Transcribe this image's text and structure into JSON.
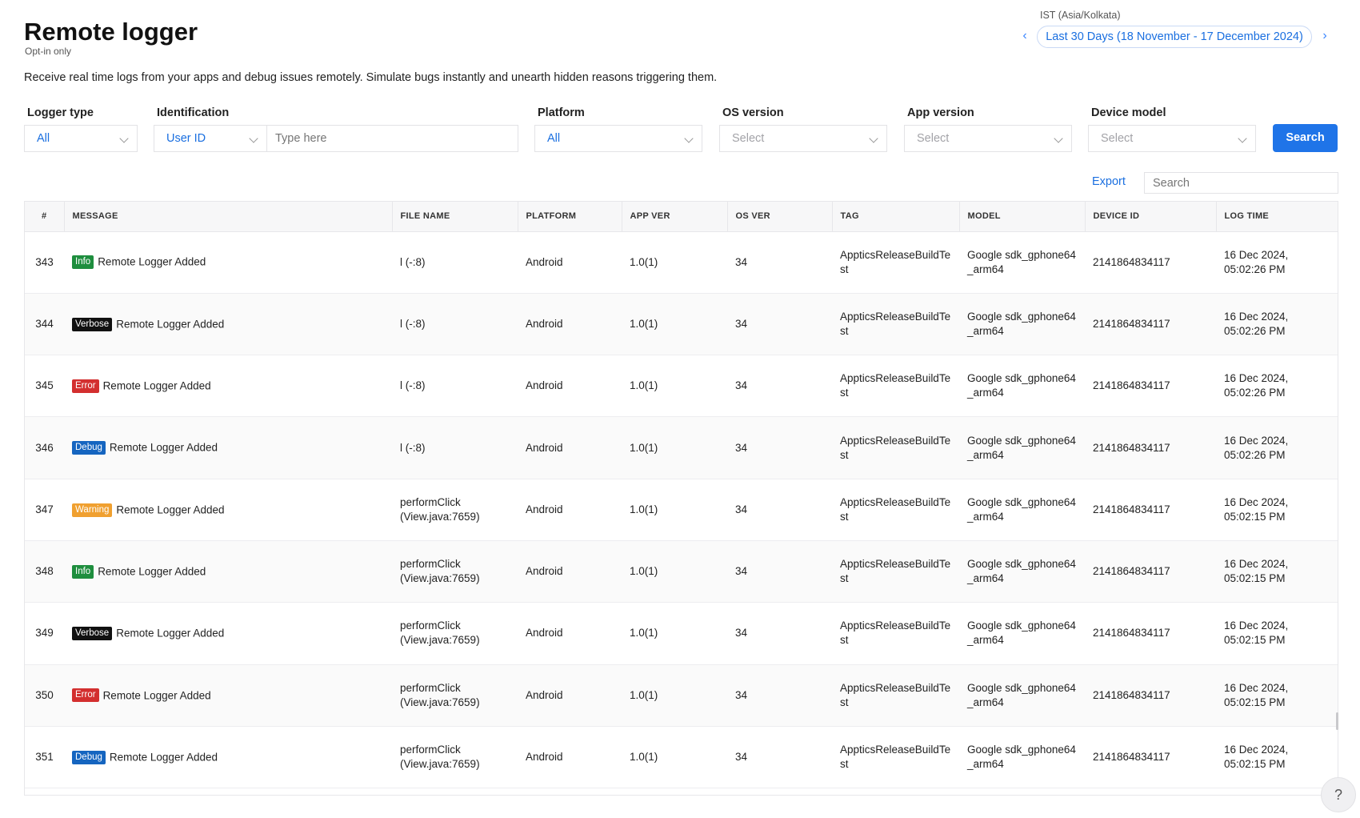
{
  "header": {
    "title": "Remote logger",
    "subtitle": "Opt-in only",
    "description": "Receive real time logs from your apps and debug issues remotely. Simulate bugs instantly and unearth hidden reasons triggering them.",
    "timezone": "IST (Asia/Kolkata)",
    "date_range": "Last 30 Days (18 November - 17 December 2024)"
  },
  "filters": {
    "logger_type": {
      "label": "Logger type",
      "value": "All"
    },
    "identification": {
      "label": "Identification",
      "value": "User ID",
      "input_placeholder": "Type here"
    },
    "platform": {
      "label": "Platform",
      "value": "All"
    },
    "os_version": {
      "label": "OS version",
      "value": "Select"
    },
    "app_version": {
      "label": "App version",
      "value": "Select"
    },
    "device_model": {
      "label": "Device model",
      "value": "Select"
    },
    "search_button": "Search"
  },
  "toolbar": {
    "export_label": "Export",
    "search_placeholder": "Search"
  },
  "table": {
    "columns": [
      "#",
      "MESSAGE",
      "FILE NAME",
      "PLATFORM",
      "APP VER",
      "OS VER",
      "TAG",
      "MODEL",
      "DEVICE ID",
      "LOG TIME"
    ],
    "rows": [
      {
        "num": "343",
        "level": "Info",
        "message": "Remote Logger Added",
        "file": "l (-:8)",
        "platform": "Android",
        "app_ver": "1.0(1)",
        "os_ver": "34",
        "tag": "AppticsReleaseBuildTest",
        "model": "Google sdk_gphone64_arm64",
        "device_id": "2141864834117",
        "log_time": "16 Dec 2024, 05:02:26 PM"
      },
      {
        "num": "344",
        "level": "Verbose",
        "message": "Remote Logger Added",
        "file": "l (-:8)",
        "platform": "Android",
        "app_ver": "1.0(1)",
        "os_ver": "34",
        "tag": "AppticsReleaseBuildTest",
        "model": "Google sdk_gphone64_arm64",
        "device_id": "2141864834117",
        "log_time": "16 Dec 2024, 05:02:26 PM"
      },
      {
        "num": "345",
        "level": "Error",
        "message": "Remote Logger Added",
        "file": "l (-:8)",
        "platform": "Android",
        "app_ver": "1.0(1)",
        "os_ver": "34",
        "tag": "AppticsReleaseBuildTest",
        "model": "Google sdk_gphone64_arm64",
        "device_id": "2141864834117",
        "log_time": "16 Dec 2024, 05:02:26 PM"
      },
      {
        "num": "346",
        "level": "Debug",
        "message": "Remote Logger Added",
        "file": "l (-:8)",
        "platform": "Android",
        "app_ver": "1.0(1)",
        "os_ver": "34",
        "tag": "AppticsReleaseBuildTest",
        "model": "Google sdk_gphone64_arm64",
        "device_id": "2141864834117",
        "log_time": "16 Dec 2024, 05:02:26 PM"
      },
      {
        "num": "347",
        "level": "Warning",
        "message": "Remote Logger Added",
        "file": "performClick (View.java:7659)",
        "platform": "Android",
        "app_ver": "1.0(1)",
        "os_ver": "34",
        "tag": "AppticsReleaseBuildTest",
        "model": "Google sdk_gphone64_arm64",
        "device_id": "2141864834117",
        "log_time": "16 Dec 2024, 05:02:15 PM"
      },
      {
        "num": "348",
        "level": "Info",
        "message": "Remote Logger Added",
        "file": "performClick (View.java:7659)",
        "platform": "Android",
        "app_ver": "1.0(1)",
        "os_ver": "34",
        "tag": "AppticsReleaseBuildTest",
        "model": "Google sdk_gphone64_arm64",
        "device_id": "2141864834117",
        "log_time": "16 Dec 2024, 05:02:15 PM"
      },
      {
        "num": "349",
        "level": "Verbose",
        "message": "Remote Logger Added",
        "file": "performClick (View.java:7659)",
        "platform": "Android",
        "app_ver": "1.0(1)",
        "os_ver": "34",
        "tag": "AppticsReleaseBuildTest",
        "model": "Google sdk_gphone64_arm64",
        "device_id": "2141864834117",
        "log_time": "16 Dec 2024, 05:02:15 PM"
      },
      {
        "num": "350",
        "level": "Error",
        "message": "Remote Logger Added",
        "file": "performClick (View.java:7659)",
        "platform": "Android",
        "app_ver": "1.0(1)",
        "os_ver": "34",
        "tag": "AppticsReleaseBuildTest",
        "model": "Google sdk_gphone64_arm64",
        "device_id": "2141864834117",
        "log_time": "16 Dec 2024, 05:02:15 PM"
      },
      {
        "num": "351",
        "level": "Debug",
        "message": "Remote Logger Added",
        "file": "performClick (View.java:7659)",
        "platform": "Android",
        "app_ver": "1.0(1)",
        "os_ver": "34",
        "tag": "AppticsReleaseBuildTest",
        "model": "Google sdk_gphone64_arm64",
        "device_id": "2141864834117",
        "log_time": "16 Dec 2024, 05:02:15 PM"
      }
    ]
  },
  "level_colors": {
    "Info": "#1e8e3e",
    "Verbose": "#111111",
    "Error": "#d32f2f",
    "Debug": "#1565c0",
    "Warning": "#f0a030"
  },
  "icons": {
    "prev": "chevron-left-icon",
    "next": "chevron-right-icon",
    "dropdown": "chevron-down-icon",
    "help": "question-mark-icon"
  },
  "help_label": "?",
  "nav": {
    "prev_glyph": "‹",
    "next_glyph": "›"
  }
}
